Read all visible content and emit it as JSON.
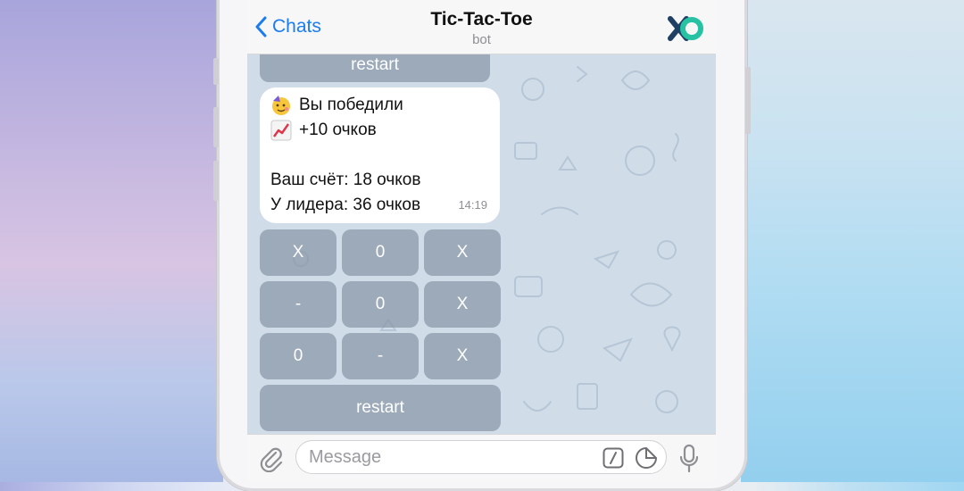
{
  "header": {
    "back_label": "Chats",
    "title": "Tic-Tac-Toe",
    "subtitle": "bot",
    "avatar_icon": "xo-logo-icon"
  },
  "chat": {
    "top_restart_label": "restart",
    "message": {
      "line1": "Вы победили",
      "line1_icon": "partying-face-emoji",
      "line2": "+10 очков",
      "line2_icon": "chart-increasing-emoji",
      "line3": "Ваш счёт: 18 очков",
      "line4": "У лидера: 36 очков",
      "time": "14:19"
    },
    "board": [
      [
        "X",
        "0",
        "X"
      ],
      [
        "-",
        "0",
        "X"
      ],
      [
        "0",
        "-",
        "X"
      ]
    ],
    "restart_label": "restart"
  },
  "input": {
    "placeholder": "Message",
    "attach_icon": "paperclip-icon",
    "command_icon": "slash-command-icon",
    "sticker_icon": "sticker-icon",
    "mic_icon": "microphone-icon"
  },
  "colors": {
    "accent": "#1b7cf2",
    "chat_bg": "#d0dde8",
    "keyboard_button": "#8896a8"
  }
}
